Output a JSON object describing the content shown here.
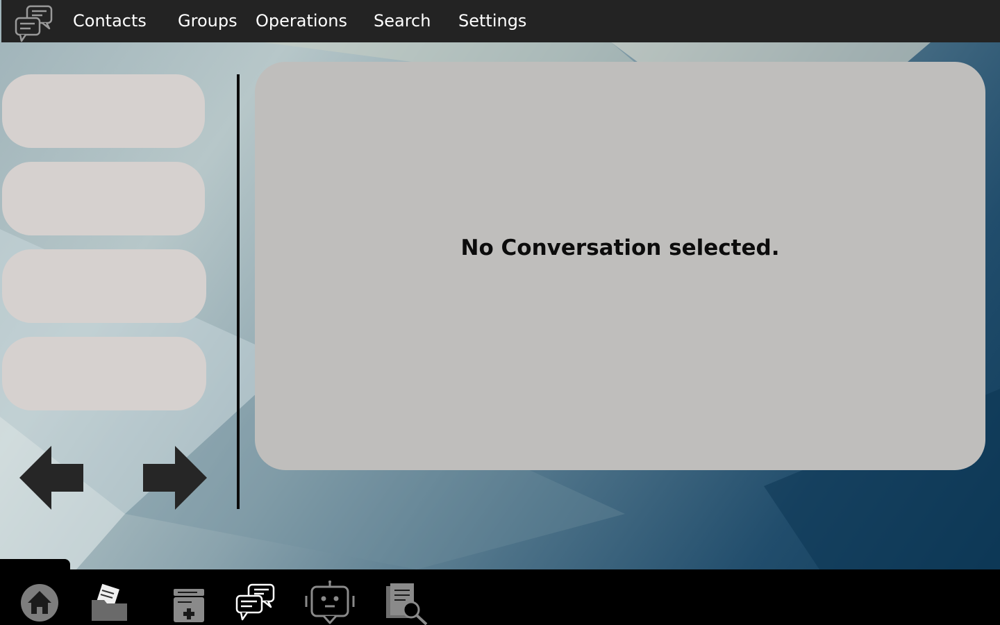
{
  "menu": {
    "items": [
      {
        "label": "Contacts"
      },
      {
        "label": "Groups"
      },
      {
        "label": "Operations"
      },
      {
        "label": "Search"
      },
      {
        "label": "Settings"
      }
    ]
  },
  "conversation_list": {
    "slot_count": 4
  },
  "main": {
    "empty_message": "No Conversation selected."
  },
  "dock": {
    "icons": [
      "home-icon",
      "folders-icon",
      "medical-record-icon",
      "chat-icon",
      "bot-icon",
      "document-search-icon"
    ]
  },
  "colors": {
    "menu_bar": "#232323",
    "panel": "#bfbebc",
    "list_slot": "#d6d1cf",
    "dock": "#000000"
  }
}
